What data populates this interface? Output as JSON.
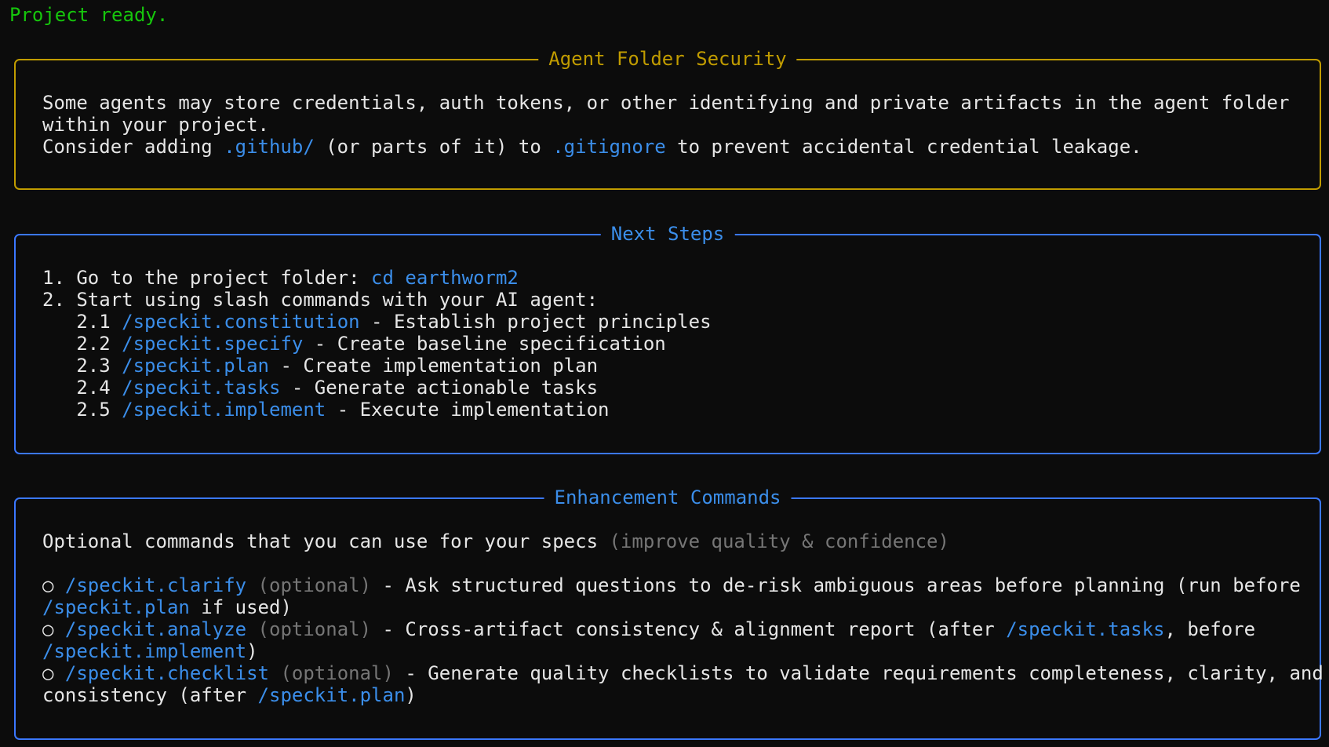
{
  "status_line": "Project ready.",
  "security_panel": {
    "title": "Agent Folder Security",
    "line1": "Some agents may store credentials, auth tokens, or other identifying and private artifacts in the agent folder",
    "line2": "within your project.",
    "line3_prefix": "Consider adding ",
    "line3_folder": ".github/",
    "line3_middle": " (or parts of it) to ",
    "line3_file": ".gitignore",
    "line3_suffix": " to prevent accidental credential leakage."
  },
  "next_steps": {
    "title": "Next Steps",
    "step1_label": "1. Go to the project folder: ",
    "step1_cmd": "cd earthworm2",
    "step2_label": "2. Start using slash commands with your AI agent:",
    "substeps": [
      {
        "num": "   2.1 ",
        "cmd": "/speckit.constitution",
        "desc": " - Establish project principles"
      },
      {
        "num": "   2.2 ",
        "cmd": "/speckit.specify",
        "desc": " - Create baseline specification"
      },
      {
        "num": "   2.3 ",
        "cmd": "/speckit.plan",
        "desc": " - Create implementation plan"
      },
      {
        "num": "   2.4 ",
        "cmd": "/speckit.tasks",
        "desc": " - Generate actionable tasks"
      },
      {
        "num": "   2.5 ",
        "cmd": "/speckit.implement",
        "desc": " - Execute implementation"
      }
    ]
  },
  "enhancement": {
    "title": "Enhancement Commands",
    "intro": "Optional commands that you can use for your specs ",
    "intro_note": "(improve quality & confidence)",
    "bullet_symbol": "○",
    "optional_tag": "(optional)",
    "items": [
      {
        "cmd": "/speckit.clarify",
        "desc": " - Ask structured questions to de-risk ambiguous areas before planning (run before",
        "cont_cmd": "/speckit.plan",
        "cont_text": " if used)"
      },
      {
        "cmd": "/speckit.analyze",
        "desc": " - Cross-artifact consistency & alignment report (after ",
        "desc_cmd": "/speckit.tasks",
        "desc_tail": ", before",
        "cont_cmd": "/speckit.implement",
        "cont_text": ")"
      },
      {
        "cmd": "/speckit.checklist",
        "desc": " - Generate quality checklists to validate requirements completeness, clarity, and",
        "cont_prefix": "consistency (after ",
        "cont_cmd": "/speckit.plan",
        "cont_text": ")"
      }
    ]
  },
  "colors": {
    "background": "#0c0c0c",
    "status_green": "#16c60c",
    "security_yellow": "#c19c00",
    "panel_blue": "#3b78ff",
    "command_blue": "#3b8eea",
    "dim_gray": "#767676"
  }
}
